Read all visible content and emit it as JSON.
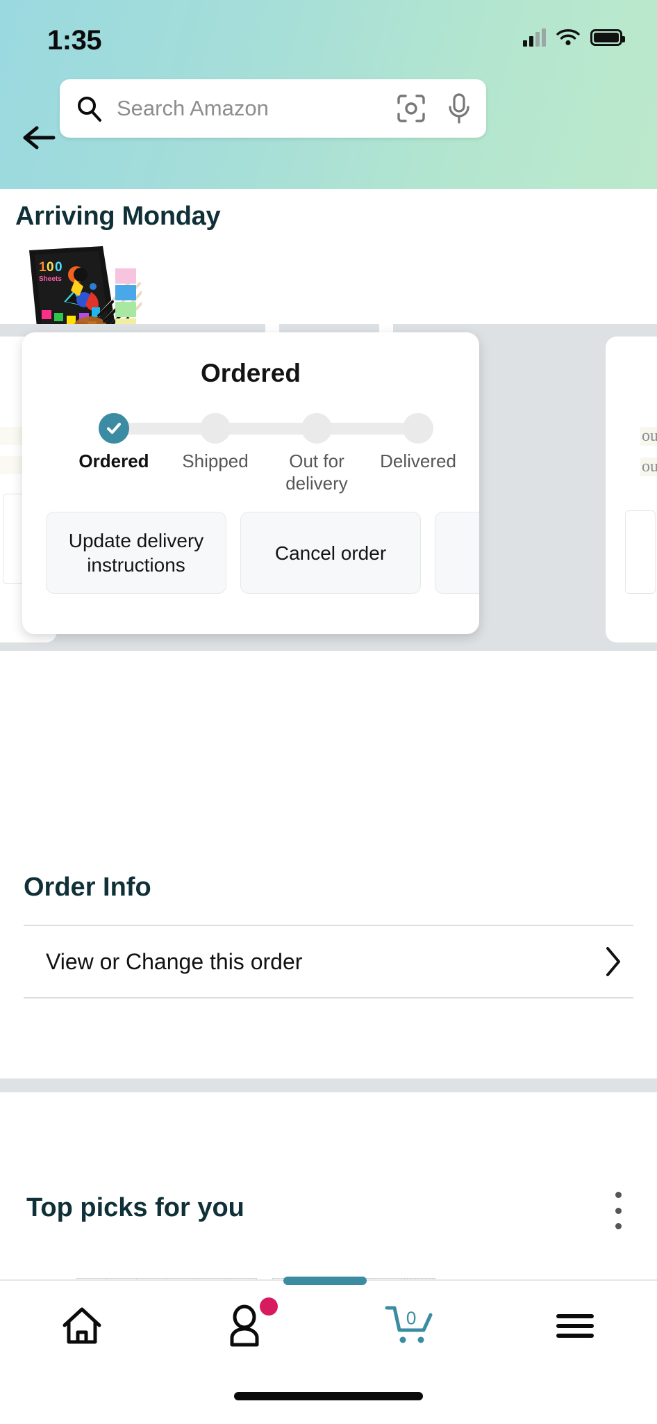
{
  "status_bar": {
    "time": "1:35",
    "signal_icon": "cellular-signal-icon",
    "wifi_icon": "wifi-icon",
    "battery_icon": "battery-icon"
  },
  "header": {
    "back_icon": "back-arrow-icon",
    "search_placeholder": "Search Amazon",
    "search_icon": "search-icon",
    "camera_icon": "camera-scan-icon",
    "mic_icon": "microphone-icon"
  },
  "arriving": {
    "title": "Arriving Monday",
    "product_badge": "100",
    "product_badge_sub": "Sheets"
  },
  "order_card": {
    "status_title": "Ordered",
    "steps": [
      {
        "label": "Ordered",
        "completed": true
      },
      {
        "label": "Shipped",
        "completed": false
      },
      {
        "label": "Out for delivery",
        "completed": false
      },
      {
        "label": "Delivered",
        "completed": false
      }
    ],
    "check_icon": "checkmark-icon",
    "actions": [
      {
        "label": "Update delivery instructions"
      },
      {
        "label": "Cancel order"
      },
      {
        "label": ""
      }
    ],
    "accent_color": "#3b8ca3",
    "inactive_color": "#eaeaea"
  },
  "order_info": {
    "title": "Order Info",
    "rows": [
      {
        "label": "View or Change this order",
        "chevron_icon": "chevron-right-icon"
      }
    ]
  },
  "top_picks": {
    "title": "Top picks for you",
    "menu_icon": "kebab-menu-icon"
  },
  "bottom_nav": {
    "items": [
      {
        "name": "home",
        "icon": "home-icon",
        "badge": false
      },
      {
        "name": "account",
        "icon": "person-icon",
        "badge": true
      },
      {
        "name": "cart",
        "icon": "shopping-cart-icon",
        "count": "0",
        "badge": false
      },
      {
        "name": "menu",
        "icon": "hamburger-menu-icon",
        "badge": false
      }
    ],
    "cart_color": "#3b8ca3",
    "badge_color": "#d81b5f"
  }
}
